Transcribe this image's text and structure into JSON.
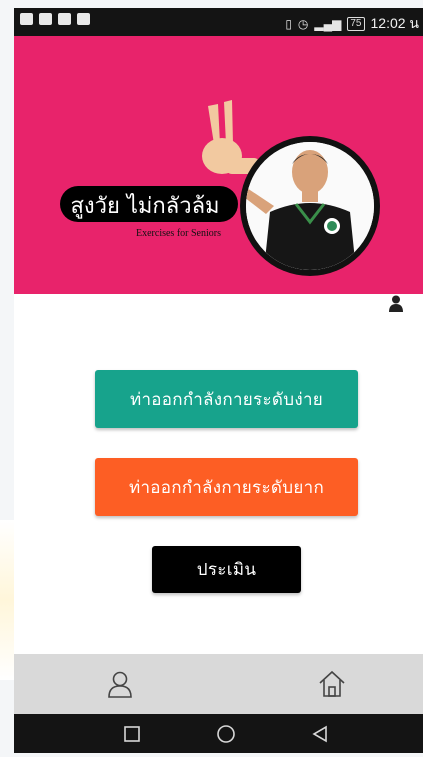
{
  "status_bar": {
    "time": "12:02 น",
    "battery": "75",
    "network": "4G"
  },
  "banner": {
    "title": "สูงวัย ไม่กลัวล้ม",
    "subtitle": "Exercises for Seniors",
    "background_color": "#e8236b"
  },
  "buttons": {
    "easy_label": "ท่าออกกำลังกายระดับง่าย",
    "hard_label": "ท่าออกกำลังกายระดับยาก",
    "evaluate_label": "ประเมิน",
    "easy_color": "#17a38c",
    "hard_color": "#fd5e24",
    "evaluate_color": "#000000"
  },
  "icons": {
    "profile": "person-icon",
    "nav_user": "user-outline-icon",
    "nav_home": "home-icon",
    "android_recent": "square-icon",
    "android_home": "circle-icon",
    "android_back": "triangle-back-icon"
  }
}
